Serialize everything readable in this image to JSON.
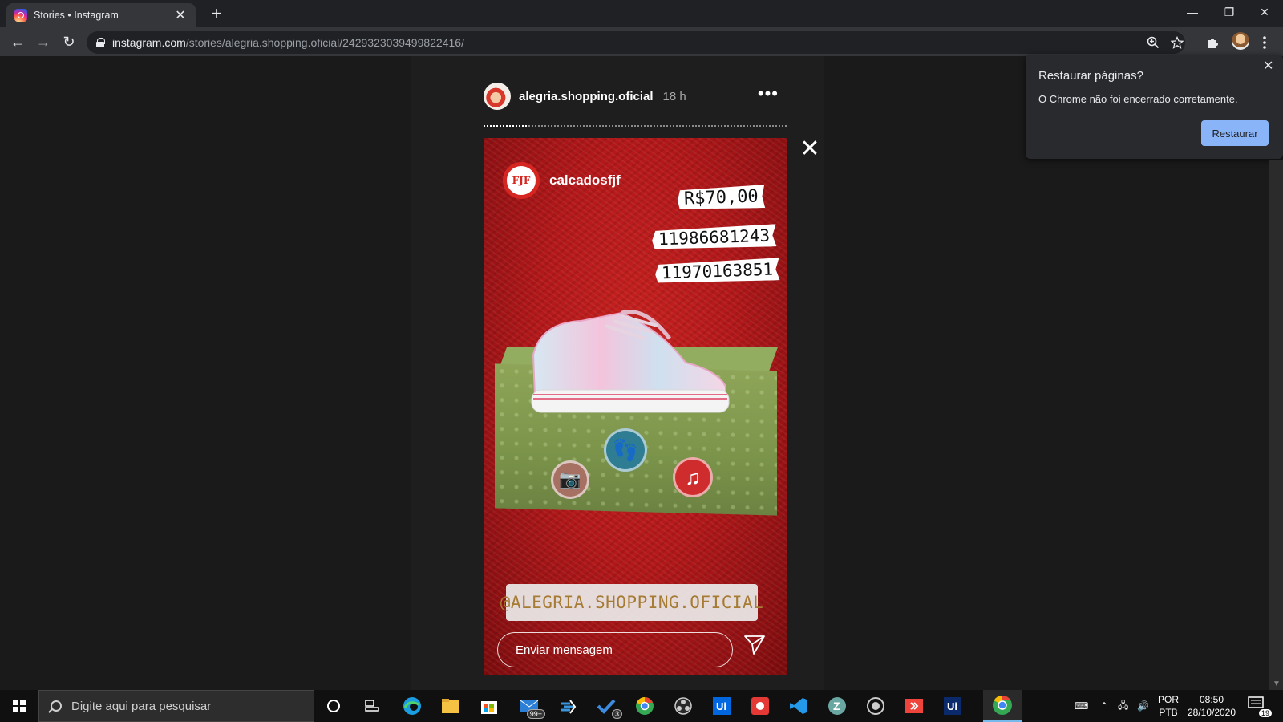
{
  "browser": {
    "tab_title": "Stories • Instagram",
    "tab_close": "✕",
    "new_tab": "+",
    "window_controls": {
      "minimize": "—",
      "restore": "❐",
      "close": "✕"
    },
    "nav": {
      "back": "←",
      "forward": "→",
      "reload": "↻"
    },
    "url_host": "instagram.com",
    "url_path": "/stories/alegria.shopping.oficial/2429323039499822416/"
  },
  "restore_popup": {
    "title": "Restaurar páginas?",
    "message": "O Chrome não foi encerrado corretamente.",
    "button": "Restaurar",
    "close": "✕"
  },
  "story": {
    "username": "alegria.shopping.oficial",
    "time": "18 h",
    "more": "•••",
    "close": "✕",
    "progress_fraction": 0.145,
    "mentioned_user": "calcadosfjf",
    "logo_text": "FJF",
    "price": "R$70,00",
    "phone_1": "11986681243",
    "phone_2": "11970163851",
    "tag": "@ALEGRIA.SHOPPING.OFICIAL",
    "reply_placeholder": "Enviar mensagem"
  },
  "taskbar": {
    "search_placeholder": "Digite aqui para pesquisar",
    "store_badge": "99+",
    "todo_badge": "3",
    "lang_line1": "POR",
    "lang_line2": "PTB",
    "time": "08:50",
    "date": "28/10/2020",
    "notif_count": "19"
  },
  "colors": {
    "accent_blue": "#8ab4f8",
    "story_red": "#b4181a",
    "tag_gold": "#a67c34"
  }
}
